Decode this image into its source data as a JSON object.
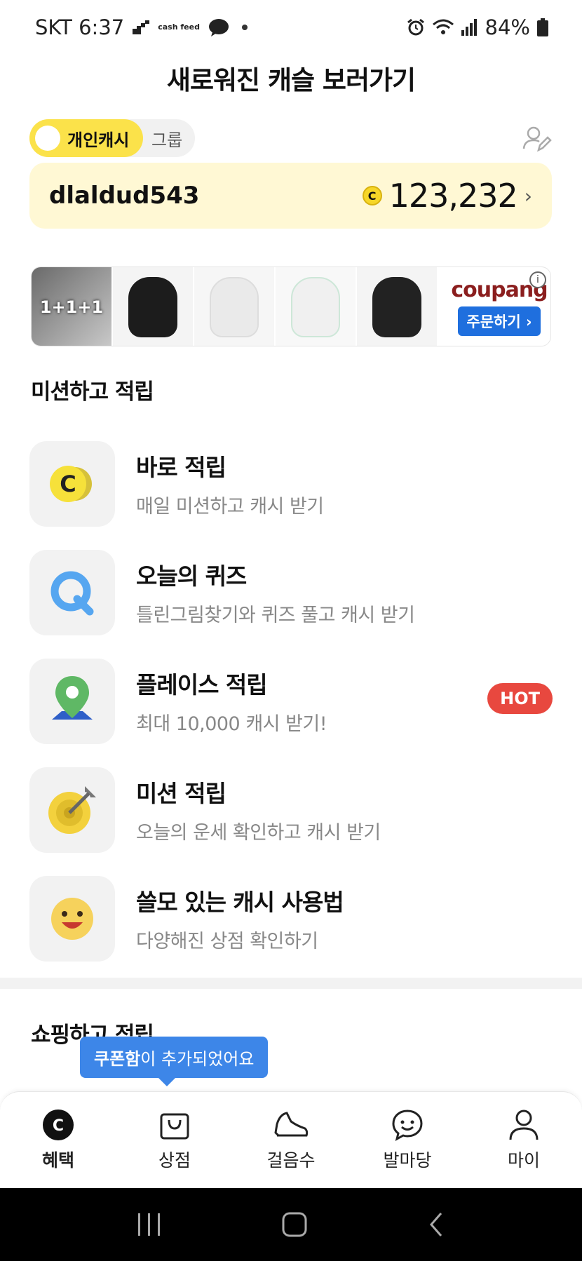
{
  "status_bar": {
    "carrier_time": "SKT 6:37",
    "cashfeed_label": "cash feed",
    "battery": "84%"
  },
  "header": {
    "title": "새로워진 캐슬 보러가기"
  },
  "toggle": {
    "personal": "개인캐시",
    "group": "그룹"
  },
  "account": {
    "username": "dlaldud543",
    "coin_symbol": "C",
    "balance": "123,232",
    "chevron": "›"
  },
  "ad": {
    "thumb1_text": "1+1+1",
    "brand": "coupang",
    "cta": "주문하기 ›",
    "info": "i"
  },
  "mission_section": {
    "title": "미션하고 적립",
    "items": [
      {
        "title": "바로 적립",
        "subtitle": "매일 미션하고 캐시 받기",
        "icon": "coin-icon"
      },
      {
        "title": "오늘의 퀴즈",
        "subtitle": "틀린그림찾기와 퀴즈 풀고 캐시 받기",
        "icon": "quiz-icon"
      },
      {
        "title": "플레이스 적립",
        "subtitle": "최대 10,000 캐시 받기!",
        "icon": "map-pin-icon",
        "badge": "HOT"
      },
      {
        "title": "미션 적립",
        "subtitle": "오늘의 운세 확인하고 캐시 받기",
        "icon": "target-icon"
      },
      {
        "title": "쓸모 있는 캐시 사용법",
        "subtitle": "다양해진 상점 확인하기",
        "icon": "smile-icon"
      }
    ]
  },
  "shopping_section": {
    "title": "쇼핑하고 적립"
  },
  "tooltip": {
    "bold": "쿠폰함",
    "rest": "이 추가되었어요"
  },
  "bottom_nav": [
    {
      "label": "혜택",
      "icon": "benefit-icon",
      "active": true
    },
    {
      "label": "상점",
      "icon": "shop-bag-icon"
    },
    {
      "label": "걸음수",
      "icon": "shoe-icon"
    },
    {
      "label": "발마당",
      "icon": "chat-smile-icon"
    },
    {
      "label": "마이",
      "icon": "person-icon"
    }
  ],
  "colors": {
    "accent_yellow": "#fbe24a",
    "card_bg": "#fff8d4",
    "hot_red": "#e8483f",
    "tooltip_blue": "#3d86e8",
    "coupang_blue": "#1f6fde"
  }
}
